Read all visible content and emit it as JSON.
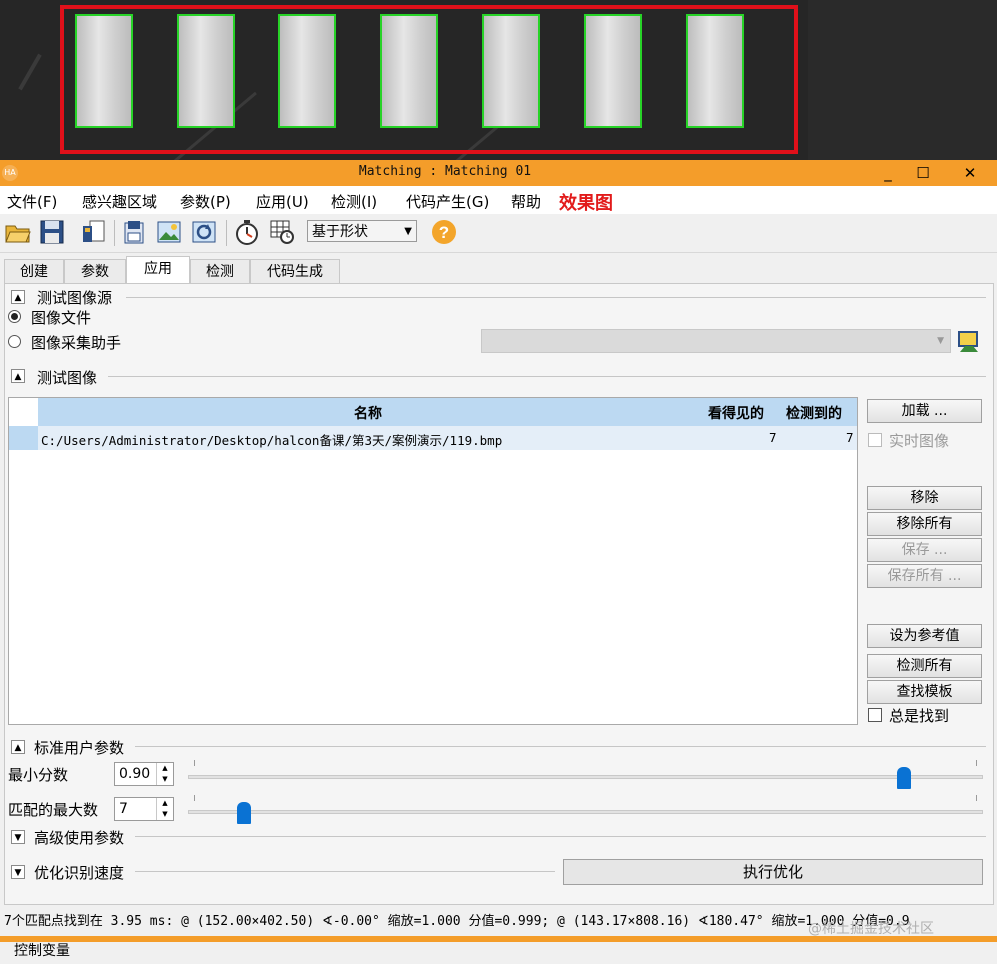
{
  "window": {
    "title": "Matching : Matching 01",
    "controls": [
      "_",
      "☐",
      "✕"
    ]
  },
  "menu": {
    "items": [
      "文件(F)",
      "感兴趣区域",
      "参数(P)",
      "应用(U)",
      "检测(I)",
      "代码产生(G)",
      "帮助"
    ],
    "annotation": "效果图"
  },
  "toolbar": {
    "icons": [
      "open-folder-icon",
      "save-icon",
      "load-file-icon",
      "save-template-icon",
      "image-icon",
      "refresh-image-icon",
      "timer-icon",
      "grid-settings-icon",
      "help-icon"
    ],
    "strategy_value": "基于形状",
    "help_glyph": "?"
  },
  "tabs": {
    "items": [
      "创建",
      "参数",
      "应用",
      "检测",
      "代码生成"
    ],
    "active": "应用"
  },
  "test_image_source": {
    "title": "测试图像源",
    "option_file": "图像文件",
    "option_acq": "图像采集助手"
  },
  "test_images": {
    "title": "测试图像",
    "columns": [
      "名称",
      "看得见的",
      "检测到的"
    ],
    "rows": [
      {
        "name": "C:/Users/Administrator/Desktop/halcon备课/第3天/案例演示/119.bmp",
        "visible": "7",
        "detected": "7"
      }
    ],
    "buttons": {
      "load": "加载 ...",
      "realtime": "实时图像",
      "remove": "移除",
      "remove_all": "移除所有",
      "save": "保存 ...",
      "save_all": "保存所有 ...",
      "set_reference": "设为参考值",
      "detect_all": "检测所有",
      "find_model": "查找模板",
      "always_find": "总是找到"
    }
  },
  "standard_params": {
    "title": "标准用户参数",
    "min_score_label": "最小分数",
    "min_score": "0.90",
    "min_score_level": 0.9,
    "max_matches_label": "匹配的最大数",
    "max_matches": "7",
    "max_matches_level": 0.07
  },
  "advanced_params": {
    "title": "高级使用参数"
  },
  "optimize": {
    "title": "优化识别速度",
    "button": "执行优化"
  },
  "status": "7个匹配点找到在 3.95 ms: @ (152.00×402.50) ∢-0.00° 缩放=1.000 分值=0.999; @ (143.17×808.16) ∢180.47° 缩放=1.000 分值=0.9",
  "control_variables": "控制变量",
  "watermark": "@稀土掘金技术社区",
  "colors": {
    "title_bar": "#f49d2a",
    "roi": "#e0101a",
    "match_outline": "#27d327",
    "slider": "#0a72d3",
    "table_header": "#bcd9f2"
  }
}
